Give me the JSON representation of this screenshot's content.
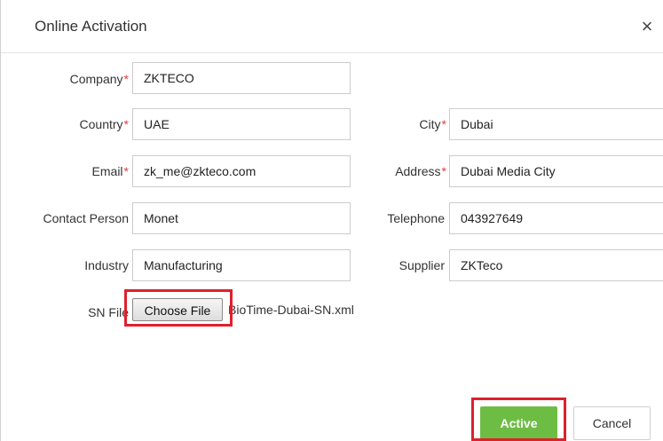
{
  "dialog": {
    "title": "Online Activation",
    "close_icon": "close-icon",
    "close_glyph": "×"
  },
  "form": {
    "company": {
      "label": "Company",
      "required": true,
      "value": "ZKTECO"
    },
    "country": {
      "label": "Country",
      "required": true,
      "value": "UAE"
    },
    "city": {
      "label": "City",
      "required": true,
      "value": "Dubai"
    },
    "email": {
      "label": "Email",
      "required": true,
      "value": "zk_me@zkteco.com"
    },
    "address": {
      "label": "Address",
      "required": true,
      "value": "Dubai Media City"
    },
    "contact_person": {
      "label": "Contact Person",
      "required": false,
      "value": "Monet"
    },
    "telephone": {
      "label": "Telephone",
      "required": false,
      "value": "043927649"
    },
    "industry": {
      "label": "Industry",
      "required": false,
      "value": "Manufacturing"
    },
    "supplier": {
      "label": "Supplier",
      "required": false,
      "value": "ZKTeco"
    },
    "sn_file": {
      "label": "SN File",
      "button_label": "Choose File",
      "file_name": "BioTime-Dubai-SN.xml"
    }
  },
  "required_mark": "*",
  "buttons": {
    "active_label": "Active",
    "cancel_label": "Cancel"
  },
  "colors": {
    "required": "#e03d3d",
    "active_button": "#6dbd45",
    "highlight": "#e0202c"
  }
}
